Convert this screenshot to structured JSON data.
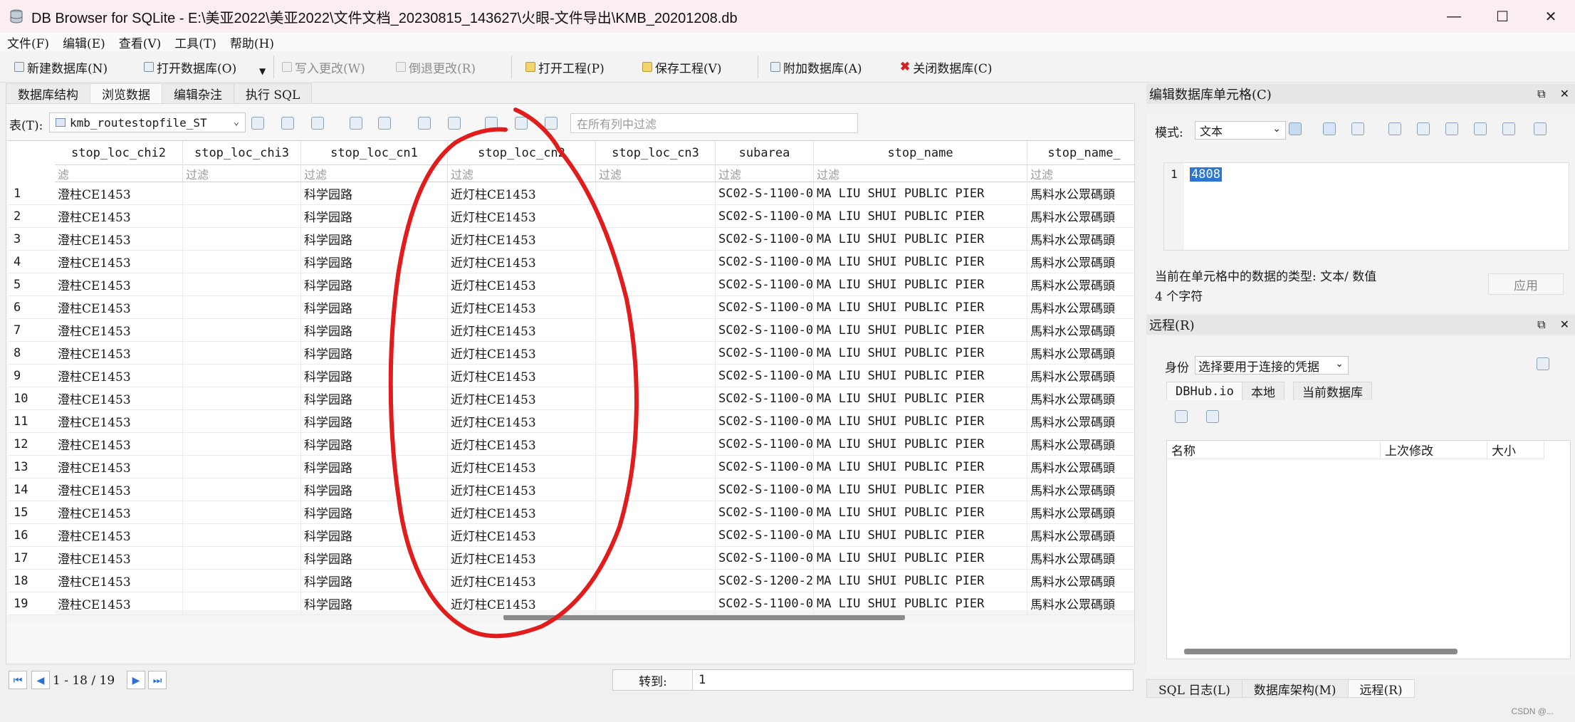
{
  "window": {
    "title": "DB Browser for SQLite - E:\\美亚2022\\美亚2022\\文件文档_20230815_143627\\火眼-文件导出\\KMB_20201208.db",
    "minimize": "—",
    "maximize": "☐",
    "close": "✕"
  },
  "menu": [
    "文件(F)",
    "编辑(E)",
    "查看(V)",
    "工具(T)",
    "帮助(H)"
  ],
  "toolbar": {
    "new_db": "新建数据库(N)",
    "open_db": "打开数据库(O)",
    "write_changes": "写入更改(W)",
    "revert_changes": "倒退更改(R)",
    "open_project": "打开工程(P)",
    "save_project": "保存工程(V)",
    "attach_db": "附加数据库(A)",
    "close_db": "关闭数据库(C)"
  },
  "main_tabs": [
    "数据库结构",
    "浏览数据",
    "编辑杂注",
    "执行 SQL"
  ],
  "browse": {
    "table_label": "表(T):",
    "table_name": "kmb_routestopfile_ST",
    "global_filter_placeholder": "在所有列中过滤",
    "filter_placeholder": "过滤",
    "columns": [
      "stop_loc_chi2",
      "stop_loc_chi3",
      "stop_loc_cn1",
      "stop_loc_cn2",
      "stop_loc_cn3",
      "subarea",
      "stop_name",
      "stop_name_"
    ],
    "first_filter_partial": "滤",
    "sort_indicator": "▼¹",
    "rows": [
      {
        "n": "1",
        "c": [
          "澄柱CE1453",
          "",
          "科学园路",
          "近灯柱CE1453",
          "",
          "SC02-S-1100-0",
          "MA LIU SHUI PUBLIC PIER",
          "馬料水公眾碼頭"
        ]
      },
      {
        "n": "2",
        "c": [
          "澄柱CE1453",
          "",
          "科学园路",
          "近灯柱CE1453",
          "",
          "SC02-S-1100-0",
          "MA LIU SHUI PUBLIC PIER",
          "馬料水公眾碼頭"
        ]
      },
      {
        "n": "3",
        "c": [
          "澄柱CE1453",
          "",
          "科学园路",
          "近灯柱CE1453",
          "",
          "SC02-S-1100-0",
          "MA LIU SHUI PUBLIC PIER",
          "馬料水公眾碼頭"
        ]
      },
      {
        "n": "4",
        "c": [
          "澄柱CE1453",
          "",
          "科学园路",
          "近灯柱CE1453",
          "",
          "SC02-S-1100-0",
          "MA LIU SHUI PUBLIC PIER",
          "馬料水公眾碼頭"
        ]
      },
      {
        "n": "5",
        "c": [
          "澄柱CE1453",
          "",
          "科学园路",
          "近灯柱CE1453",
          "",
          "SC02-S-1100-0",
          "MA LIU SHUI PUBLIC PIER",
          "馬料水公眾碼頭"
        ]
      },
      {
        "n": "6",
        "c": [
          "澄柱CE1453",
          "",
          "科学园路",
          "近灯柱CE1453",
          "",
          "SC02-S-1100-0",
          "MA LIU SHUI PUBLIC PIER",
          "馬料水公眾碼頭"
        ]
      },
      {
        "n": "7",
        "c": [
          "澄柱CE1453",
          "",
          "科学园路",
          "近灯柱CE1453",
          "",
          "SC02-S-1100-0",
          "MA LIU SHUI PUBLIC PIER",
          "馬料水公眾碼頭"
        ]
      },
      {
        "n": "8",
        "c": [
          "澄柱CE1453",
          "",
          "科学园路",
          "近灯柱CE1453",
          "",
          "SC02-S-1100-0",
          "MA LIU SHUI PUBLIC PIER",
          "馬料水公眾碼頭"
        ]
      },
      {
        "n": "9",
        "c": [
          "澄柱CE1453",
          "",
          "科学园路",
          "近灯柱CE1453",
          "",
          "SC02-S-1100-0",
          "MA LIU SHUI PUBLIC PIER",
          "馬料水公眾碼頭"
        ]
      },
      {
        "n": "10",
        "c": [
          "澄柱CE1453",
          "",
          "科学园路",
          "近灯柱CE1453",
          "",
          "SC02-S-1100-0",
          "MA LIU SHUI PUBLIC PIER",
          "馬料水公眾碼頭"
        ]
      },
      {
        "n": "11",
        "c": [
          "澄柱CE1453",
          "",
          "科学园路",
          "近灯柱CE1453",
          "",
          "SC02-S-1100-0",
          "MA LIU SHUI PUBLIC PIER",
          "馬料水公眾碼頭"
        ]
      },
      {
        "n": "12",
        "c": [
          "澄柱CE1453",
          "",
          "科学园路",
          "近灯柱CE1453",
          "",
          "SC02-S-1100-0",
          "MA LIU SHUI PUBLIC PIER",
          "馬料水公眾碼頭"
        ]
      },
      {
        "n": "13",
        "c": [
          "澄柱CE1453",
          "",
          "科学园路",
          "近灯柱CE1453",
          "",
          "SC02-S-1100-0",
          "MA LIU SHUI PUBLIC PIER",
          "馬料水公眾碼頭"
        ]
      },
      {
        "n": "14",
        "c": [
          "澄柱CE1453",
          "",
          "科学园路",
          "近灯柱CE1453",
          "",
          "SC02-S-1100-0",
          "MA LIU SHUI PUBLIC PIER",
          "馬料水公眾碼頭"
        ]
      },
      {
        "n": "15",
        "c": [
          "澄柱CE1453",
          "",
          "科学园路",
          "近灯柱CE1453",
          "",
          "SC02-S-1100-0",
          "MA LIU SHUI PUBLIC PIER",
          "馬料水公眾碼頭"
        ]
      },
      {
        "n": "16",
        "c": [
          "澄柱CE1453",
          "",
          "科学园路",
          "近灯柱CE1453",
          "",
          "SC02-S-1100-0",
          "MA LIU SHUI PUBLIC PIER",
          "馬料水公眾碼頭"
        ]
      },
      {
        "n": "17",
        "c": [
          "澄柱CE1453",
          "",
          "科学园路",
          "近灯柱CE1453",
          "",
          "SC02-S-1100-0",
          "MA LIU SHUI PUBLIC PIER",
          "馬料水公眾碼頭"
        ]
      },
      {
        "n": "18",
        "c": [
          "澄柱CE1453",
          "",
          "科学园路",
          "近灯柱CE1453",
          "",
          "SC02-S-1200-2",
          "MA LIU SHUI PUBLIC PIER",
          "馬料水公眾碼頭"
        ]
      },
      {
        "n": "19",
        "c": [
          "澄柱CE1453",
          "",
          "科学园路",
          "近灯柱CE1453",
          "",
          "SC02-S-1100-0",
          "MA LIU SHUI PUBLIC PIER",
          "馬料水公眾碼頭"
        ]
      }
    ]
  },
  "nav": {
    "range": "1 - 18 / 19",
    "goto_label": "转到:",
    "goto_value": "1"
  },
  "edit_cell": {
    "title": "编辑数据库单元格(C)",
    "mode_label": "模式:",
    "mode_value": "文本",
    "line_no": "1",
    "value": "4808",
    "type_info": "当前在单元格中的数据的类型: 文本/ 数值",
    "char_count": "4 个字符",
    "apply": "应用"
  },
  "remote": {
    "title": "远程(R)",
    "identity_label": "身份",
    "identity_value": "选择要用于连接的凭据",
    "tabs": [
      "DBHub.io",
      "本地",
      "当前数据库"
    ],
    "columns": [
      "名称",
      "上次修改",
      "大小"
    ]
  },
  "bottom_tabs": [
    "SQL 日志(L)",
    "数据库架构(M)",
    "远程(R)"
  ],
  "watermark": "CSDN @..."
}
